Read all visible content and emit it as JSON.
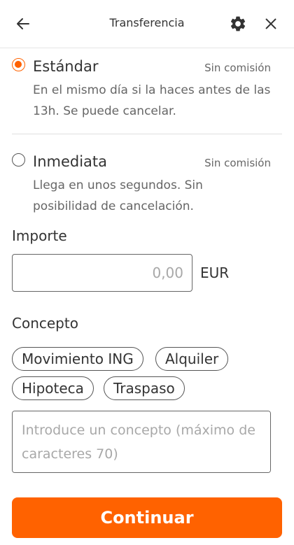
{
  "header": {
    "title": "Transferencia",
    "back_icon": "arrow-left-icon",
    "settings_icon": "gear-icon",
    "close_icon": "close-icon"
  },
  "transfer_options": [
    {
      "title": "Estándar",
      "fee": "Sin comisión",
      "description": "En el mismo día si la haces antes de las 13h. Se puede cancelar.",
      "selected": true
    },
    {
      "title": "Inmediata",
      "fee": "Sin comisión",
      "description": "Llega en unos segundos. Sin posibilidad de cancelación.",
      "selected": false
    }
  ],
  "amount": {
    "label": "Importe",
    "value": "",
    "placeholder": "0,00",
    "currency": "EUR"
  },
  "concept": {
    "label": "Concepto",
    "suggestions": [
      "Movimiento ING",
      "Alquiler",
      "Hipoteca",
      "Traspaso"
    ],
    "value": "",
    "placeholder": "Introduce un concepto (máximo de caracteres 70)"
  },
  "continue_label": "Continuar",
  "colors": {
    "accent": "#ff6200",
    "text": "#333333",
    "muted_text": "#666666"
  }
}
